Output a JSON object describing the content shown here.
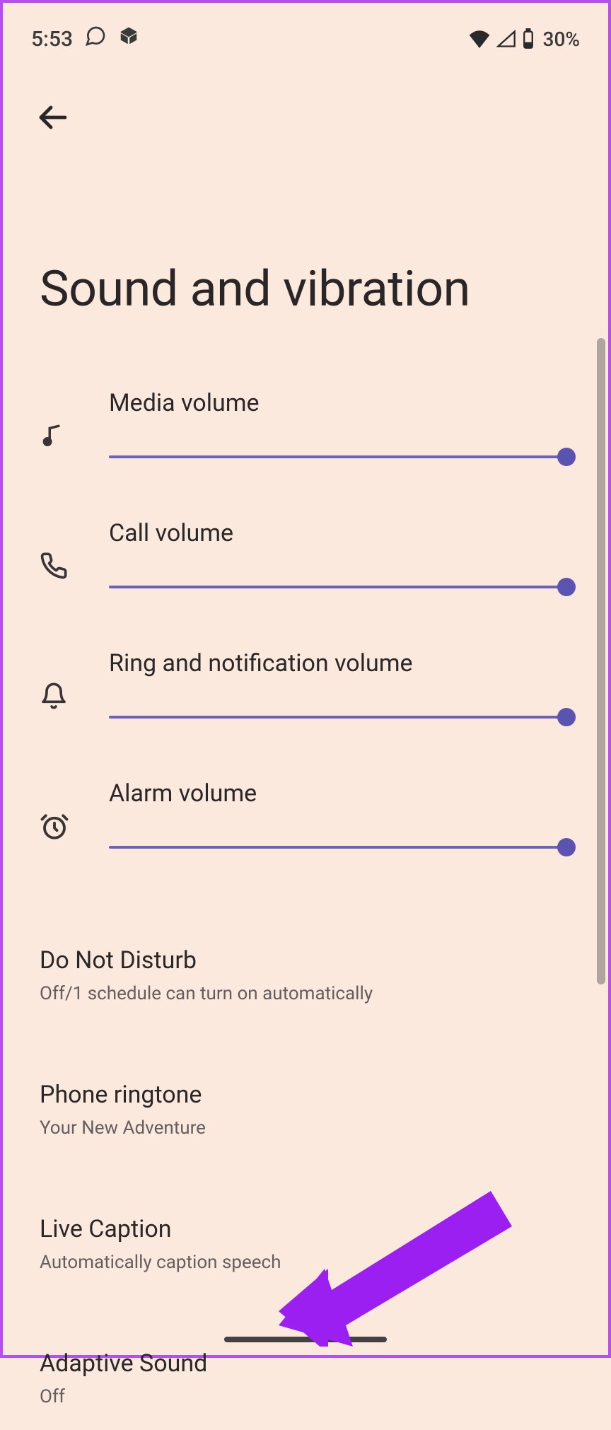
{
  "status": {
    "time": "5:53",
    "battery_text": "30%"
  },
  "page": {
    "title": "Sound and vibration"
  },
  "sliders": [
    {
      "label": "Media volume",
      "value": 100
    },
    {
      "label": "Call volume",
      "value": 100
    },
    {
      "label": "Ring and notification volume",
      "value": 100
    },
    {
      "label": "Alarm volume",
      "value": 100
    }
  ],
  "items": [
    {
      "title": "Do Not Disturb",
      "sub": "Off/1 schedule can turn on automatically"
    },
    {
      "title": "Phone ringtone",
      "sub": "Your New Adventure"
    },
    {
      "title": "Live Caption",
      "sub": "Automatically caption speech"
    },
    {
      "title": "Adaptive Sound",
      "sub": "Off"
    }
  ]
}
